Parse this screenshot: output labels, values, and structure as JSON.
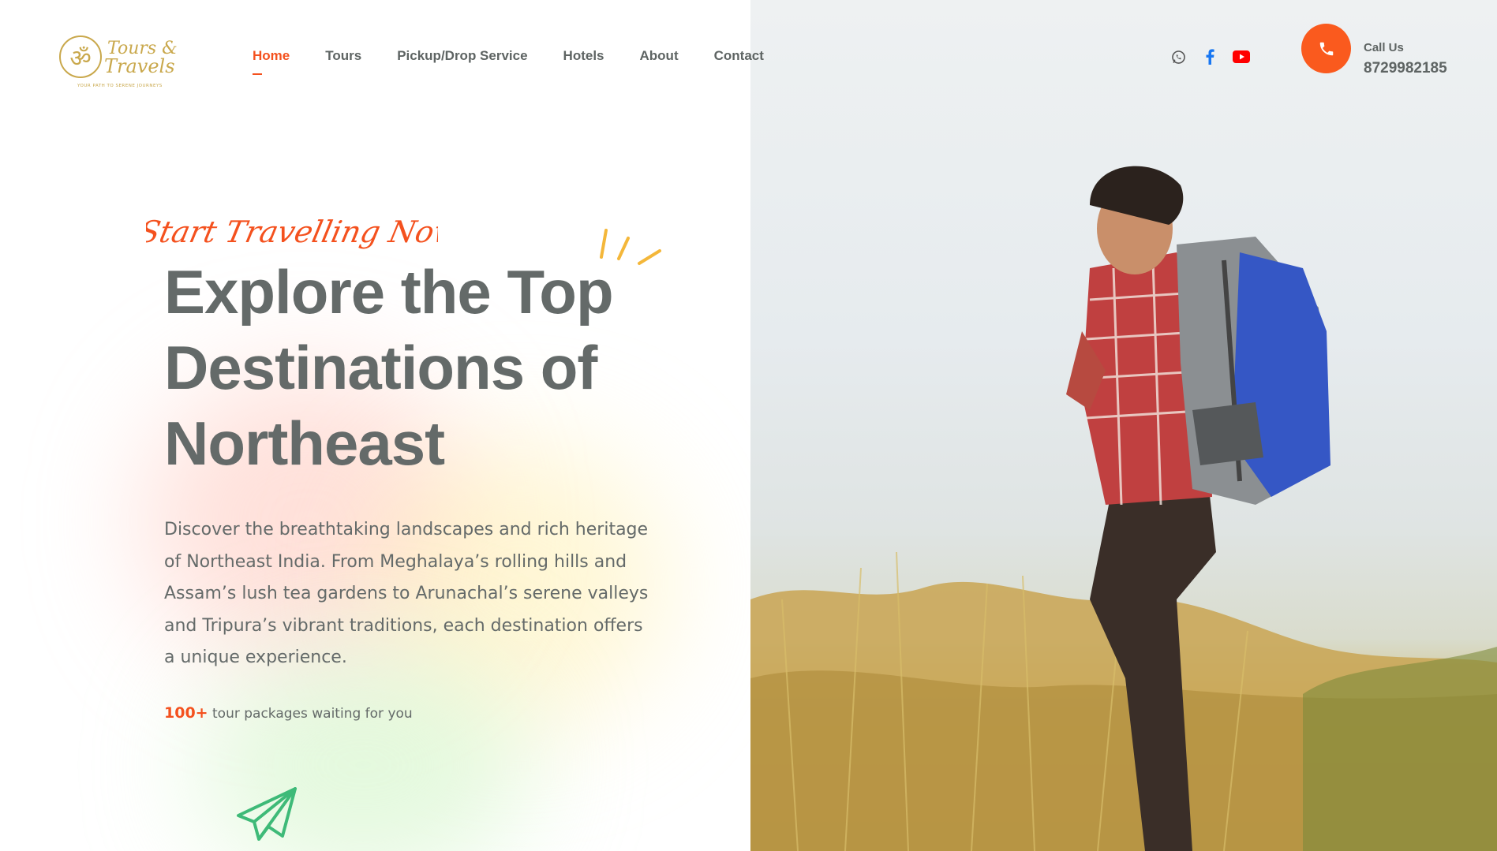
{
  "brand": {
    "logo_symbol": "ॐ",
    "logo_line1": "Tours &",
    "logo_line2": "Travels",
    "tagline": "YOUR PATH TO SERENE JOURNEYS",
    "accent_color": "#f4511e",
    "text_color": "#646a69"
  },
  "nav": {
    "items": [
      {
        "label": "Home",
        "active": true
      },
      {
        "label": "Tours"
      },
      {
        "label": "Pickup/Drop Service"
      },
      {
        "label": "Hotels"
      },
      {
        "label": "About"
      },
      {
        "label": "Contact"
      }
    ]
  },
  "socials": [
    {
      "icon": "whatsapp-icon"
    },
    {
      "icon": "facebook-icon"
    },
    {
      "icon": "youtube-icon"
    }
  ],
  "contact": {
    "icon": "phone-icon",
    "label": "Call Us",
    "number": "8729982185"
  },
  "hero": {
    "script_text": "Start Travelling Now",
    "headline_lines": [
      "Explore the Top",
      "Destinations of",
      "Northeast"
    ],
    "description": "Discover the breathtaking landscapes and rich heritage of Northeast India. From Meghalaya’s rolling hills and Assam’s lush tea gardens to Arunachal’s serene valleys and Tripura’s vibrant traditions, each destination offers a unique experience.",
    "packages_count": "100+",
    "packages_text": " tour packages waiting for you",
    "photo_subject": "backpacker hiking on grassy hill"
  }
}
